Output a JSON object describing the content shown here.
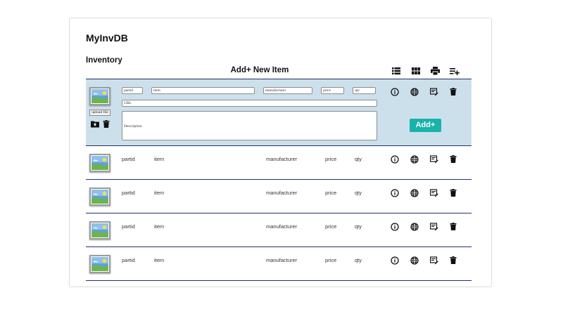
{
  "app": {
    "title": "MyInvDB"
  },
  "section": {
    "title": "Inventory"
  },
  "add_form": {
    "title": "Add+ New Item",
    "upload_label": "upload file",
    "add_button": "Add+",
    "placeholders": {
      "partid": "partid",
      "item": "item",
      "manufacturer": "manufacturer",
      "price": "price",
      "qty": "qty",
      "url": "URL",
      "description": "Description"
    }
  },
  "toolbar_icons": [
    "list-view-icon",
    "grid-view-icon",
    "print-icon",
    "add-to-list-icon"
  ],
  "row_action_icons": [
    "info-icon",
    "globe-icon",
    "edit-note-icon",
    "delete-icon"
  ],
  "items": [
    {
      "partid": "partid",
      "item": "item",
      "manufacturer": "manufacturer",
      "price": "price",
      "qty": "qty"
    },
    {
      "partid": "partid",
      "item": "item",
      "manufacturer": "manufacturer",
      "price": "price",
      "qty": "qty"
    },
    {
      "partid": "partid",
      "item": "item",
      "manufacturer": "manufacturer",
      "price": "price",
      "qty": "qty"
    },
    {
      "partid": "partid",
      "item": "item",
      "manufacturer": "manufacturer",
      "price": "price",
      "qty": "qty"
    }
  ],
  "colors": {
    "accent": "#18b3ab",
    "edit_row_bg": "#cce0ec",
    "row_divider": "#22306e"
  }
}
